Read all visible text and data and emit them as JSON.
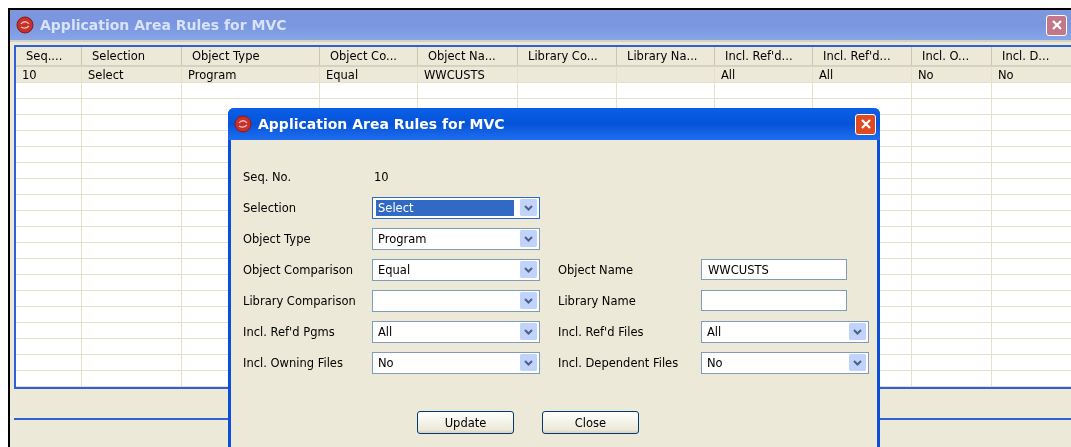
{
  "window": {
    "title": "Application Area Rules for MVC",
    "active": false
  },
  "table": {
    "columns": [
      "Seq....",
      "Selection",
      "Object Type",
      "Object Co...",
      "Object Na...",
      "Library Co...",
      "Library Na...",
      "Incl. Ref'd...",
      "Incl. Ref'd...",
      "Incl. O...",
      "Incl. D..."
    ],
    "rows": [
      {
        "selected": true,
        "cells": [
          "10",
          "Select",
          "Program",
          "Equal",
          "WWCUSTS",
          "",
          "",
          "All",
          "All",
          "No",
          "No"
        ]
      }
    ]
  },
  "dialog": {
    "title": "Application Area Rules for MVC",
    "active": true,
    "rows": [
      {
        "fields": [
          {
            "label": "Seq. No.",
            "kind": "static",
            "value": "10",
            "focused": false
          }
        ]
      },
      {
        "fields": [
          {
            "label": "Selection",
            "kind": "combo",
            "value": "Select",
            "focused": true
          }
        ]
      },
      {
        "fields": [
          {
            "label": "Object Type",
            "kind": "combo",
            "value": "Program",
            "focused": false
          }
        ]
      },
      {
        "fields": [
          {
            "label": "Object Comparison",
            "kind": "combo",
            "value": "Equal",
            "focused": false
          },
          {
            "label": "Object Name",
            "kind": "input",
            "value": "WWCUSTS",
            "focused": false
          }
        ]
      },
      {
        "fields": [
          {
            "label": "Library Comparison",
            "kind": "combo",
            "focused": false
          },
          {
            "label": "Library Name",
            "kind": "input",
            "focused": false
          }
        ]
      },
      {
        "fields": [
          {
            "label": "Incl. Ref'd Pgms",
            "kind": "combo",
            "value": "All",
            "focused": false
          },
          {
            "label": "Incl. Ref'd Files",
            "kind": "combo",
            "value": "All",
            "focused": false
          }
        ]
      },
      {
        "fields": [
          {
            "label": "Incl. Owning Files",
            "kind": "combo",
            "value": "No",
            "focused": false
          },
          {
            "label": "Incl. Dependent Files",
            "kind": "combo",
            "value": "No",
            "focused": false
          }
        ]
      }
    ],
    "buttons": [
      "Update",
      "Close"
    ]
  }
}
